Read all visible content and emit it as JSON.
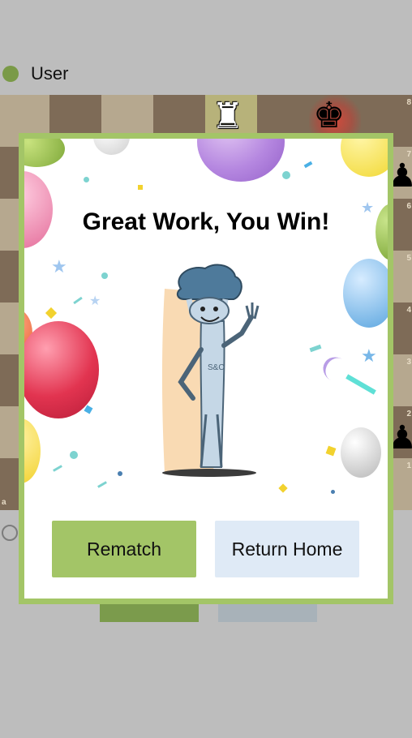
{
  "player": {
    "name": "User",
    "dot_color": "#7a9a47"
  },
  "board": {
    "rank_labels": [
      "8",
      "7",
      "6",
      "5",
      "4",
      "3",
      "2",
      "1"
    ],
    "file_label": "a",
    "pieces": {
      "white_rook": "♜",
      "black_king": "♚",
      "black_pawn": "♟"
    },
    "colors": {
      "light": "#b6a88f",
      "dark": "#7e6b57",
      "check_highlight": "#d14a3c"
    }
  },
  "modal": {
    "title": "Great Work, You Win!",
    "buttons": {
      "rematch": "Rematch",
      "return_home": "Return Home"
    },
    "mascot_icon": "celebrating-chess-piece-icon",
    "border_color": "#a3c567"
  }
}
